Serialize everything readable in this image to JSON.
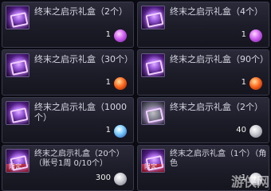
{
  "items": [
    {
      "title": "终末之启示礼盒（2个）",
      "price": "1",
      "currency_icon": "purple-gem-icon"
    },
    {
      "title": "终末之启示礼盒（4个）",
      "price": "1",
      "currency_icon": "purple-gem-icon"
    },
    {
      "title": "终末之启示礼盒（30个）",
      "price": "1",
      "currency_icon": "orange-gem-icon"
    },
    {
      "title": "终末之启示礼盒（90个）",
      "price": "1",
      "currency_icon": "orange-gem-icon"
    },
    {
      "title": "终末之启示礼盒（1000个）",
      "price": "1",
      "currency_icon": "blue-gem-icon"
    },
    {
      "title": "终末之启示礼盒（2个）",
      "price": "40",
      "currency_icon": "silver-coin-icon"
    },
    {
      "title": "终末之启示礼盒（20个）（账号1周 0/10个）",
      "price": "300",
      "currency_icon": "silver-coin-icon",
      "badge": "限定"
    },
    {
      "title": "终末之启示礼盒（1个）（角色",
      "price": "1",
      "currency_icon": "silver-coin-icon",
      "badge": "限定"
    }
  ],
  "watermark": "游侠网"
}
